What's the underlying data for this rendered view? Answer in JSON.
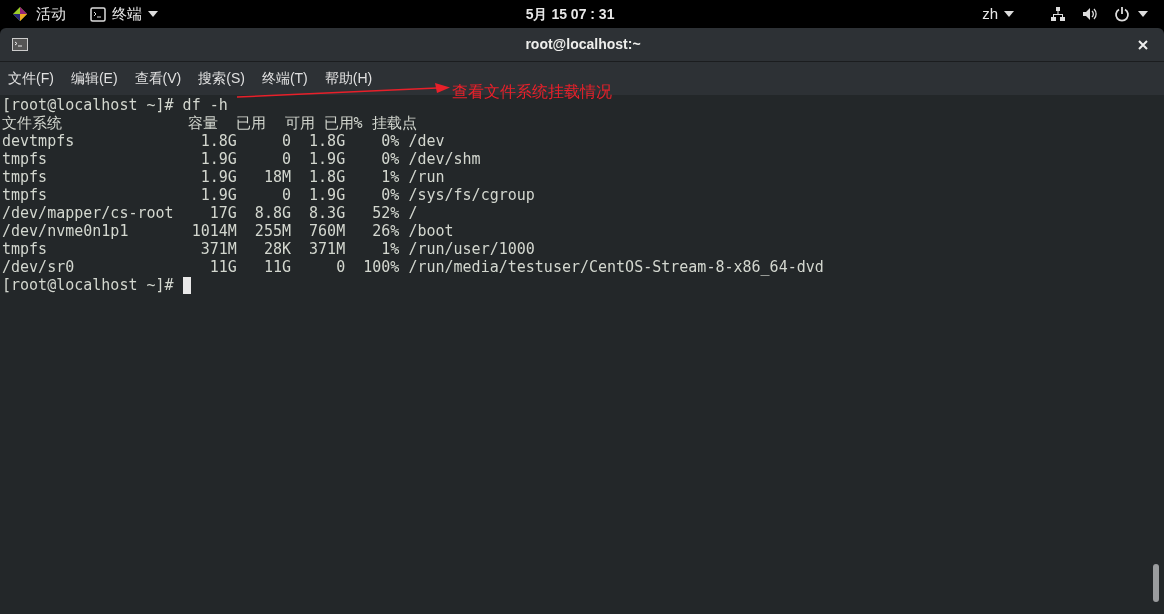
{
  "top_bar": {
    "activities": "活动",
    "app_menu": "终端",
    "clock": "5月 15 07 : 31",
    "input_method": "zh"
  },
  "window": {
    "title": "root@localhost:~"
  },
  "menu": [
    "文件(F)",
    "编辑(E)",
    "查看(V)",
    "搜索(S)",
    "终端(T)",
    "帮助(H)"
  ],
  "terminal": {
    "lines": [
      "[root@localhost ~]# df -h",
      "文件系统              容量  已用  可用 已用% 挂载点",
      "devtmpfs              1.8G     0  1.8G    0% /dev",
      "tmpfs                 1.9G     0  1.9G    0% /dev/shm",
      "tmpfs                 1.9G   18M  1.8G    1% /run",
      "tmpfs                 1.9G     0  1.9G    0% /sys/fs/cgroup",
      "/dev/mapper/cs-root    17G  8.8G  8.3G   52% /",
      "/dev/nvme0n1p1       1014M  255M  760M   26% /boot",
      "tmpfs                 371M   28K  371M    1% /run/user/1000",
      "/dev/sr0               11G   11G     0  100% /run/media/testuser/CentOS-Stream-8-x86_64-dvd"
    ],
    "prompt": "[root@localhost ~]# "
  },
  "annotation": {
    "text": "查看文件系统挂载情况"
  }
}
